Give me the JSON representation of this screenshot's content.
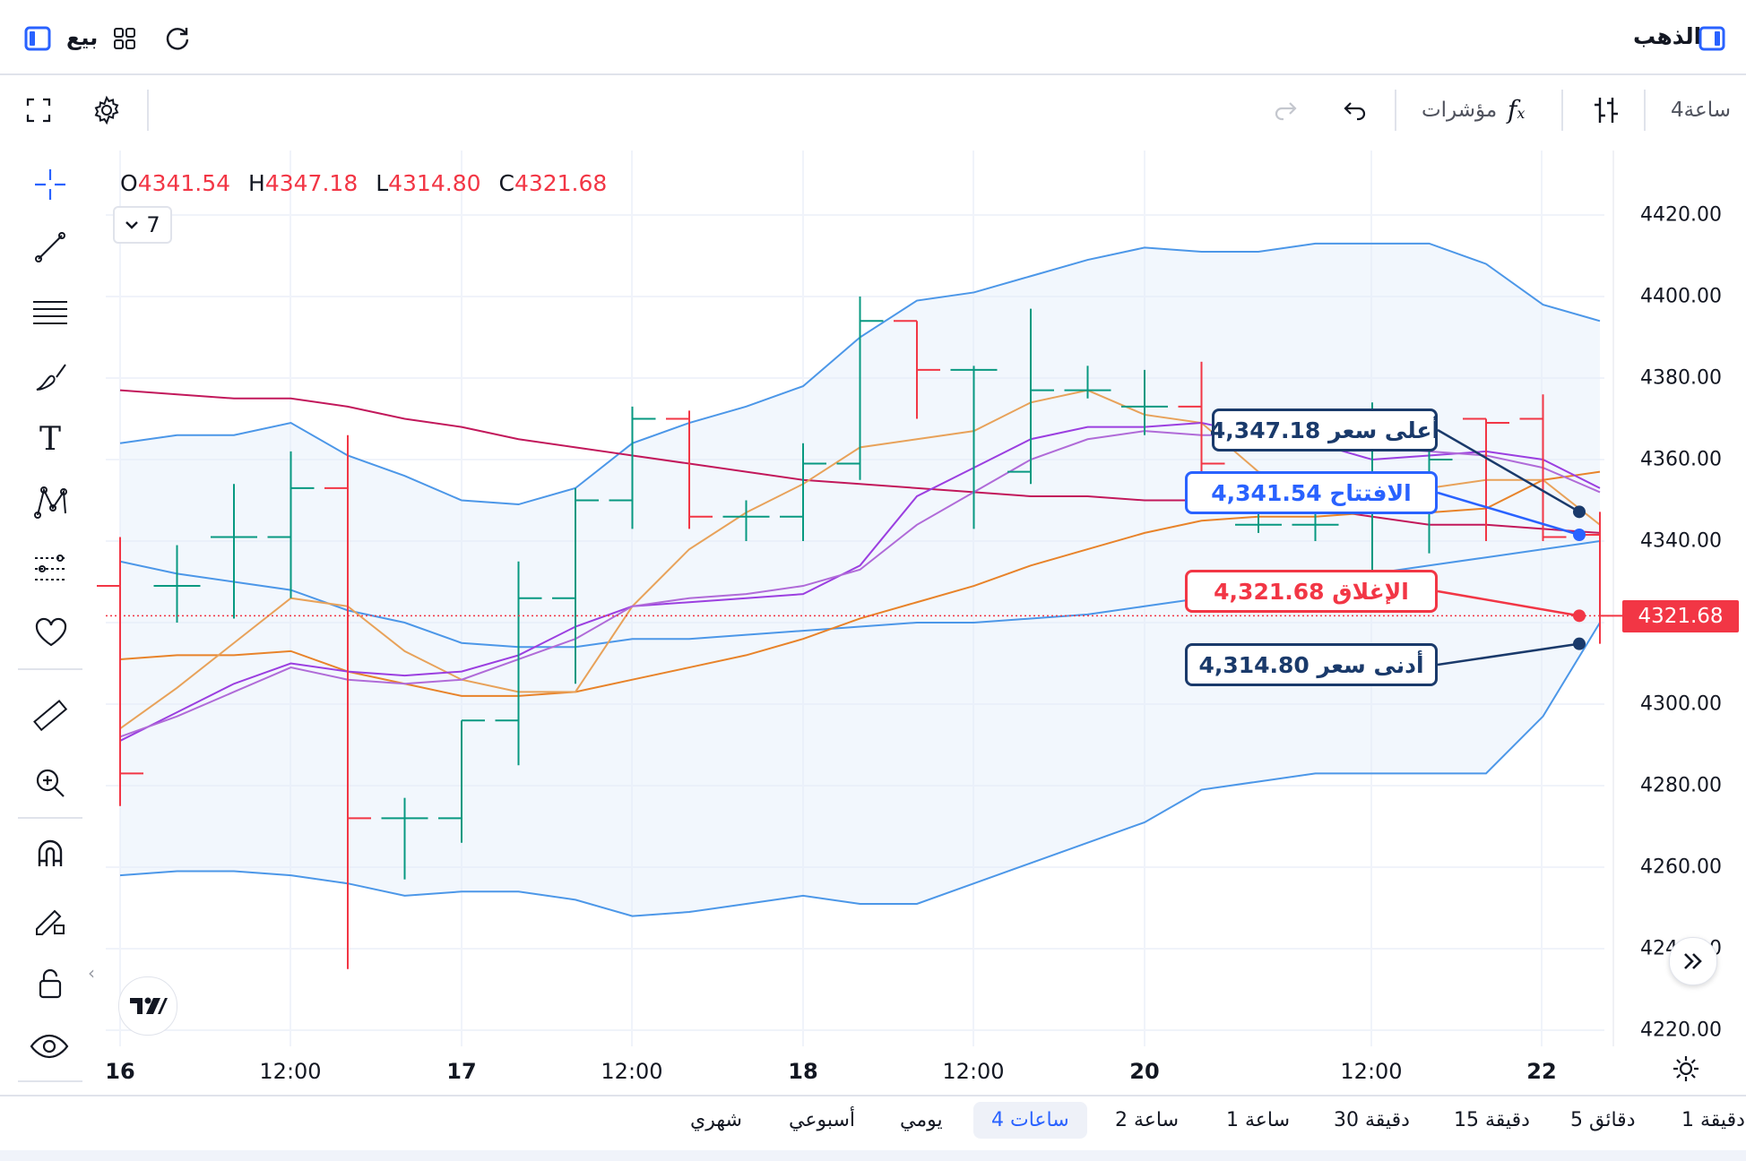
{
  "header": {
    "title": "الذهب",
    "sell_label": "بيع"
  },
  "toolbar": {
    "interval": "4ساعة",
    "indicators_label": "مؤشرات"
  },
  "ohlc": {
    "o_label": "O",
    "o_value": "4341.54",
    "h_label": "H",
    "h_value": "4347.18",
    "l_label": "L",
    "l_value": "4314.80",
    "c_label": "C",
    "c_value": "4321.68",
    "indicators_count": "7"
  },
  "price_axis": {
    "labels": [
      "4420.00",
      "4400.00",
      "4380.00",
      "4360.00",
      "4340.00",
      "4300.00",
      "4280.00",
      "4260.00",
      "4240.00",
      "4220.00"
    ],
    "current_price": "4321.68"
  },
  "time_axis": {
    "labels": [
      {
        "text": "16",
        "bold": true
      },
      {
        "text": "12:00",
        "bold": false
      },
      {
        "text": "17",
        "bold": true
      },
      {
        "text": "12:00",
        "bold": false
      },
      {
        "text": "18",
        "bold": true
      },
      {
        "text": "12:00",
        "bold": false
      },
      {
        "text": "20",
        "bold": true
      },
      {
        "text": "12:00",
        "bold": false
      },
      {
        "text": "22",
        "bold": true
      }
    ]
  },
  "callouts": {
    "high": "أعلى سعر 4,347.18",
    "open": "الافتتاح 4,341.54",
    "close": "الإغلاق 4,321.68",
    "low": "أدنى سعر 4,314.80"
  },
  "timeframes": [
    "1 دقيقة",
    "5 دقائق",
    "15 دقيقة",
    "30 دقيقة",
    "1 ساعة",
    "2 ساعة",
    "4 ساعات",
    "يومي",
    "أسبوعي",
    "شهري"
  ],
  "timeframe_active": "4 ساعات",
  "colors": {
    "up": "#089981",
    "down": "#f23645",
    "accent": "#2962ff",
    "bb": "#4c97e8",
    "ma_orange": "#e8832a",
    "ma_light_orange": "#e8a25a",
    "ma_purple": "#9b3fe0",
    "ma_violet": "#b06bd8",
    "ma_crimson": "#c2185b"
  },
  "chart_data": {
    "type": "ohlc",
    "y_range": [
      4210,
      4430
    ],
    "bars": [
      {
        "o": 4329,
        "h": 4341,
        "l": 4275,
        "c": 4283
      },
      {
        "o": 4329,
        "h": 4339,
        "l": 4320,
        "c": 4329
      },
      {
        "o": 4341,
        "h": 4354,
        "l": 4321,
        "c": 4341
      },
      {
        "o": 4341,
        "h": 4362,
        "l": 4326,
        "c": 4353
      },
      {
        "o": 4353,
        "h": 4366,
        "l": 4235,
        "c": 4272
      },
      {
        "o": 4272,
        "h": 4277,
        "l": 4257,
        "c": 4272
      },
      {
        "o": 4272,
        "h": 4296,
        "l": 4266,
        "c": 4296
      },
      {
        "o": 4296,
        "h": 4335,
        "l": 4285,
        "c": 4326
      },
      {
        "o": 4326,
        "h": 4353,
        "l": 4305,
        "c": 4350
      },
      {
        "o": 4350,
        "h": 4373,
        "l": 4343,
        "c": 4370
      },
      {
        "o": 4370,
        "h": 4372,
        "l": 4343,
        "c": 4346
      },
      {
        "o": 4346,
        "h": 4350,
        "l": 4340,
        "c": 4346
      },
      {
        "o": 4346,
        "h": 4364,
        "l": 4340,
        "c": 4359
      },
      {
        "o": 4359,
        "h": 4400,
        "l": 4355,
        "c": 4394
      },
      {
        "o": 4394,
        "h": 4394,
        "l": 4370,
        "c": 4382
      },
      {
        "o": 4382,
        "h": 4383,
        "l": 4343,
        "c": 4382
      },
      {
        "o": 4357,
        "h": 4397,
        "l": 4354,
        "c": 4377
      },
      {
        "o": 4377,
        "h": 4383,
        "l": 4375,
        "c": 4377
      },
      {
        "o": 4373,
        "h": 4382,
        "l": 4366,
        "c": 4373
      },
      {
        "o": 4373,
        "h": 4384,
        "l": 4357,
        "c": 4359
      },
      {
        "o": 4344,
        "h": 4350,
        "l": 4342,
        "c": 4344
      },
      {
        "o": 4344,
        "h": 4350,
        "l": 4340,
        "c": 4344
      },
      {
        "o": 4350,
        "h": 4374,
        "l": 4332,
        "c": 4355
      },
      {
        "o": 4350,
        "h": 4364,
        "l": 4337,
        "c": 4360
      },
      {
        "o": 4370,
        "h": 4370,
        "l": 4340,
        "c": 4369
      },
      {
        "o": 4370,
        "h": 4376,
        "l": 4340,
        "c": 4341
      },
      {
        "o": 4341.54,
        "h": 4347.18,
        "l": 4314.8,
        "c": 4321.68
      }
    ],
    "bb_upper": [
      4364,
      4366,
      4366,
      4369,
      4361,
      4356,
      4350,
      4349,
      4353,
      4364,
      4369,
      4373,
      4378,
      4390,
      4399,
      4401,
      4405,
      4409,
      4412,
      4411,
      4411,
      4413,
      4413,
      4413,
      4408,
      4398,
      4394
    ],
    "bb_middle": [
      4335,
      4332,
      4330,
      4328,
      4323,
      4320,
      4315,
      4314,
      4314,
      4316,
      4316,
      4317,
      4318,
      4319,
      4320,
      4320,
      4321,
      4322,
      4324,
      4326,
      4328,
      4330,
      4332,
      4334,
      4336,
      4338,
      4340
    ],
    "bb_lower": [
      4258,
      4259,
      4259,
      4258,
      4256,
      4253,
      4254,
      4254,
      4252,
      4248,
      4249,
      4251,
      4253,
      4251,
      4251,
      4256,
      4261,
      4266,
      4271,
      4279,
      4281,
      4283,
      4283,
      4283,
      4283,
      4297,
      4320
    ],
    "ma_orange": [
      4311,
      4312,
      4312,
      4313,
      4308,
      4305,
      4302,
      4302,
      4303,
      4306,
      4309,
      4312,
      4316,
      4321,
      4325,
      4329,
      4334,
      4338,
      4342,
      4345,
      4346,
      4346,
      4347,
      4347,
      4348,
      4355,
      4357
    ],
    "ma_light_orange": [
      4294,
      4304,
      4315,
      4326,
      4324,
      4313,
      4306,
      4303,
      4303,
      4324,
      4338,
      4347,
      4354,
      4363,
      4365,
      4367,
      4374,
      4377,
      4371,
      4369,
      4357,
      4355,
      4350,
      4353,
      4355,
      4355,
      4344
    ],
    "ma_purple": [
      4291,
      4298,
      4305,
      4310,
      4308,
      4307,
      4308,
      4312,
      4319,
      4324,
      4325,
      4326,
      4327,
      4334,
      4351,
      4358,
      4365,
      4368,
      4368,
      4369,
      4366,
      4364,
      4360,
      4361,
      4362,
      4360,
      4353
    ],
    "ma_violet": [
      4292,
      4297,
      4303,
      4309,
      4306,
      4305,
      4306,
      4311,
      4316,
      4324,
      4326,
      4327,
      4329,
      4333,
      4344,
      4352,
      4360,
      4365,
      4367,
      4366,
      4366,
      4365,
      4363,
      4362,
      4361,
      4358,
      4352
    ],
    "ma_crimson": [
      4377,
      4376,
      4375,
      4375,
      4373,
      4370,
      4368,
      4365,
      4363,
      4361,
      4359,
      4357,
      4355,
      4354,
      4353,
      4352,
      4351,
      4351,
      4350,
      4350,
      4349,
      4348,
      4346,
      4344,
      4344,
      4343,
      4342
    ]
  }
}
